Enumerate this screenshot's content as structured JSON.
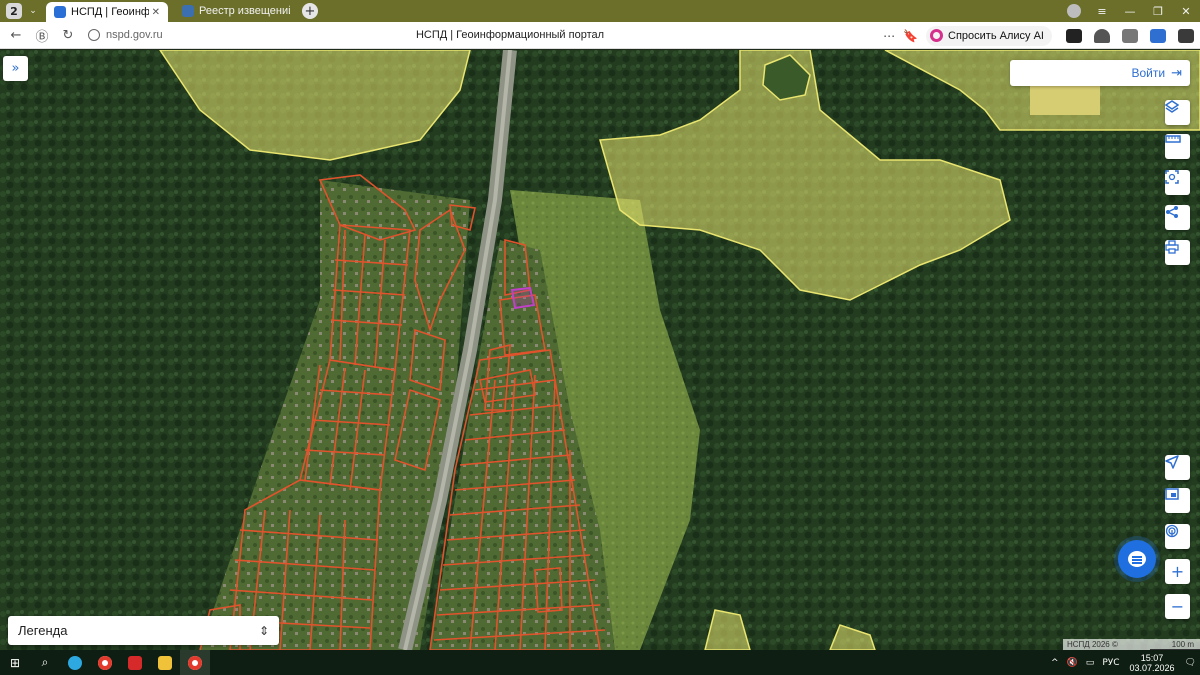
{
  "browser": {
    "tab_count": "2",
    "tabs": [
      {
        "title": "НСПД | Геоинформаци",
        "active": true,
        "close": "✕"
      },
      {
        "title": "Реестр извещений",
        "active": false
      }
    ],
    "new_tab_icon": "plus-icon",
    "url": "nspd.gov.ru",
    "page_title": "НСПД | Геоинформационный портал",
    "alice_button": "Спросить Алису AI"
  },
  "map": {
    "expand_icon": "»",
    "login_label": "Войти",
    "legend_label": "Легенда",
    "attribution": "НСПД 2026 ©",
    "scale_label": "100 m",
    "right_controls_top": [
      "layers-icon",
      "ruler-icon",
      "select-area-icon",
      "share-icon",
      "print-icon"
    ],
    "right_controls_bottom": [
      "locate-icon",
      "minimap-icon",
      "fingerprint-icon"
    ],
    "zoom_in": "+",
    "zoom_out": "−",
    "colors": {
      "accent": "#2f6fd1",
      "parcel_outline": "#e0532c",
      "zone_fill": "#e9e56f",
      "forest": "#223a1f",
      "meadow": "#6f8a3e",
      "highlight": "#c040c8"
    }
  },
  "taskbar": {
    "lang": "РУС",
    "time": "15:07",
    "date": "03.07.2026"
  }
}
